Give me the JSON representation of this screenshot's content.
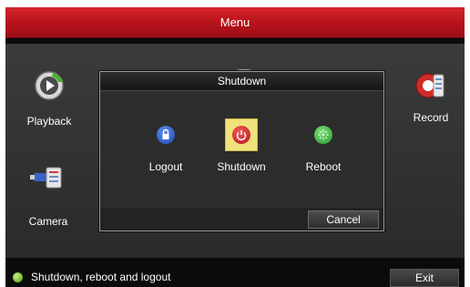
{
  "window": {
    "title": "Menu"
  },
  "menu_items": {
    "playback": "Playback",
    "record": "Record",
    "camera": "Camera"
  },
  "dialog": {
    "title": "Shutdown",
    "options": {
      "logout": "Logout",
      "shutdown": "Shutdown",
      "reboot": "Reboot"
    },
    "cancel_label": "Cancel"
  },
  "statusbar": {
    "text": "Shutdown, reboot and logout",
    "exit_label": "Exit"
  },
  "icons": {
    "logout": "lock-icon",
    "shutdown": "power-icon",
    "reboot": "reboot-icon",
    "playback": "playback-icon",
    "record": "record-icon",
    "camera": "camera-icon",
    "status": "status-dot-icon"
  },
  "colors": {
    "titlebar": "#c21c24",
    "logout_button": "#2a5ec9",
    "shutdown_button": "#d1262c",
    "reboot_button": "#3fb64a",
    "selected_highlight": "#efe27a",
    "status_dot": "#6cbf1e"
  }
}
